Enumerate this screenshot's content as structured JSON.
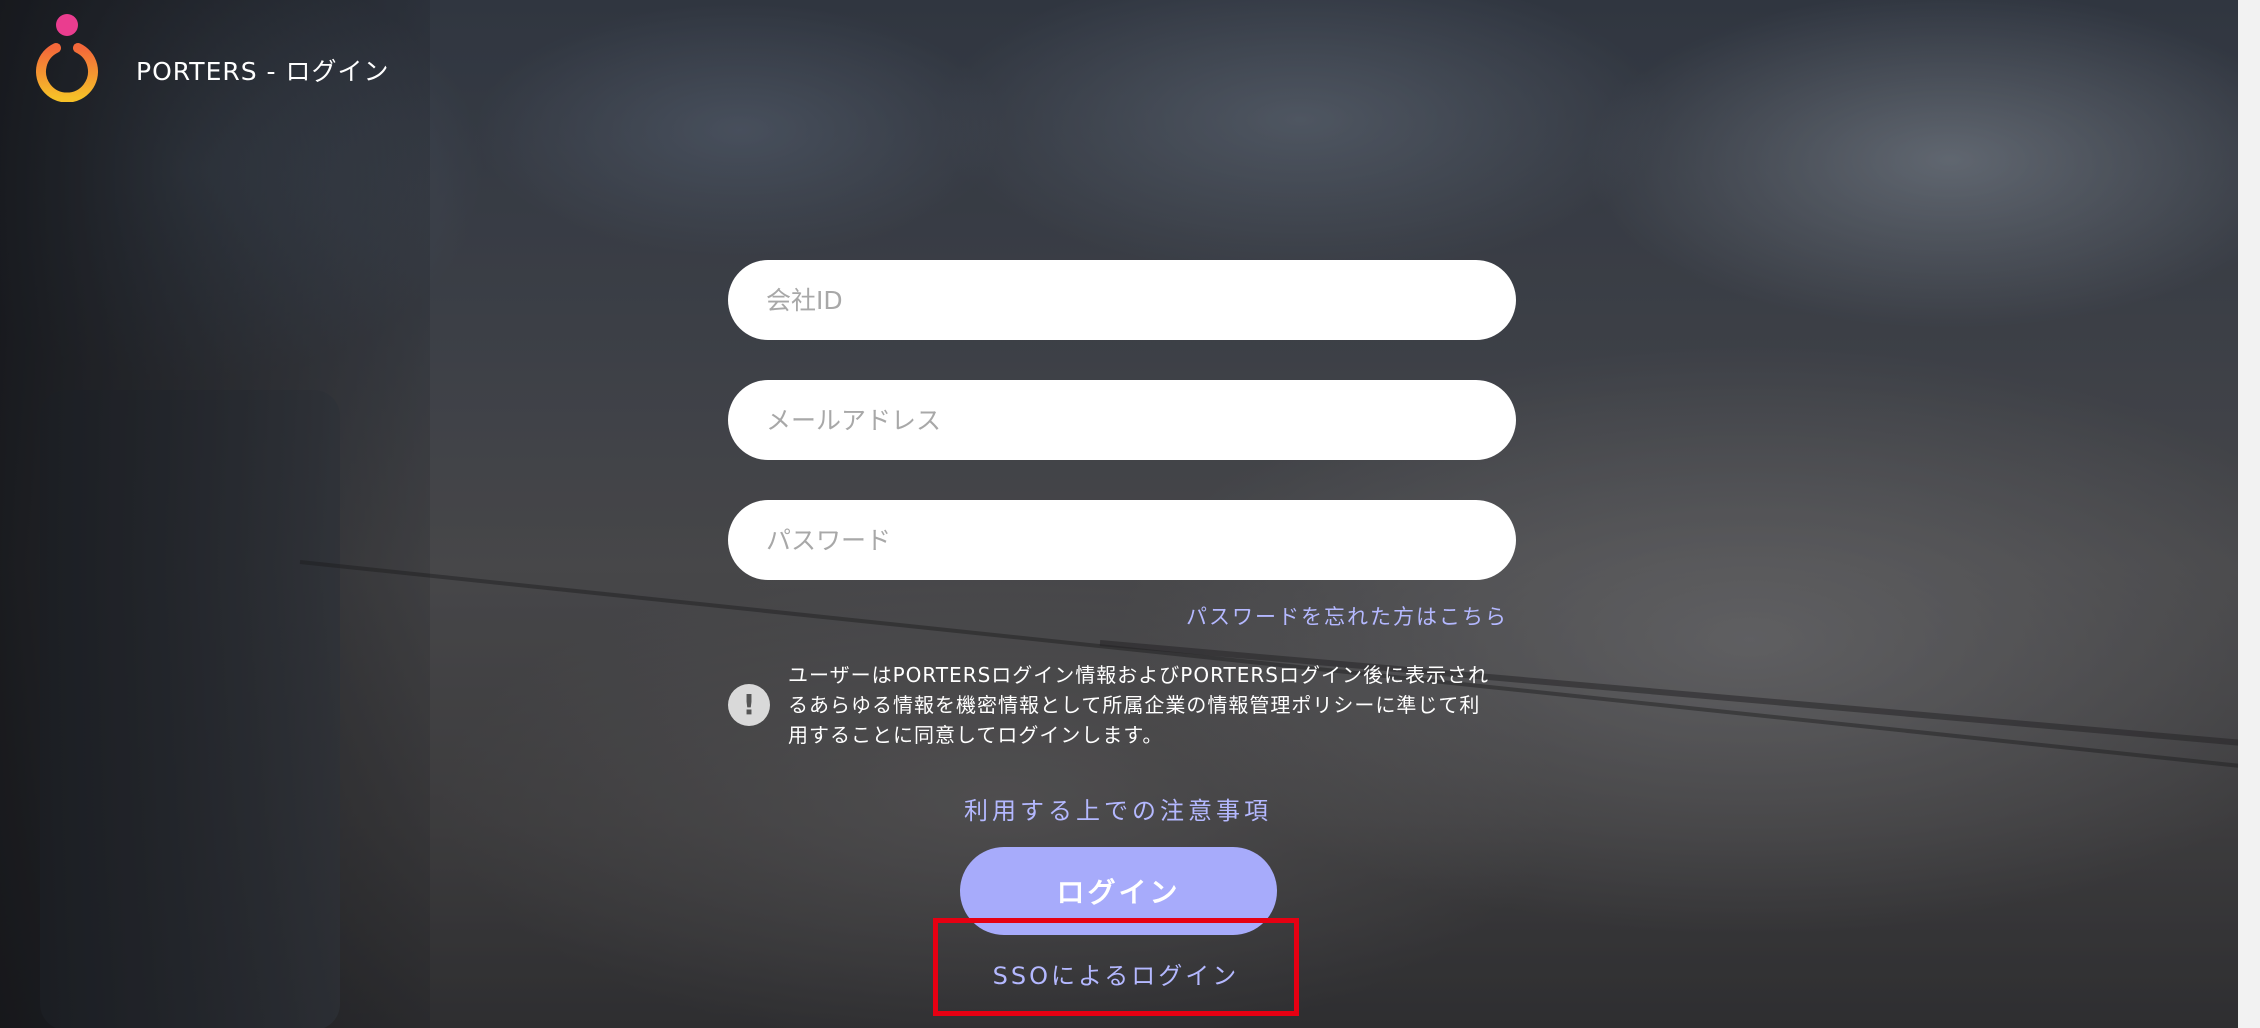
{
  "header": {
    "app_title": "PORTERS - ログイン",
    "logo_icon": "porters-logo-icon"
  },
  "form": {
    "company_id": {
      "placeholder": "会社ID",
      "value": ""
    },
    "email": {
      "placeholder": "メールアドレス",
      "value": ""
    },
    "password": {
      "placeholder": "パスワード",
      "value": ""
    },
    "forgot_password_label": "パスワードを忘れた方はこちら"
  },
  "notice": {
    "icon": "exclamation-icon",
    "text": "ユーザーはPORTERSログイン情報およびPORTERSログイン後に表示されるあらゆる情報を機密情報として所属企業の情報管理ポリシーに準じて利用することに同意してログインします。"
  },
  "actions": {
    "terms_label": "利用する上での注意事項",
    "login_label": "ログイン",
    "sso_label": "SSOによるログイン"
  },
  "colors": {
    "accent": "#a7abfb",
    "link": "#b4b8ff",
    "highlight": "#e60012",
    "logo_pink": "#ea3d8f",
    "logo_orange": "#f39a2d",
    "logo_yellow": "#f6c028"
  }
}
